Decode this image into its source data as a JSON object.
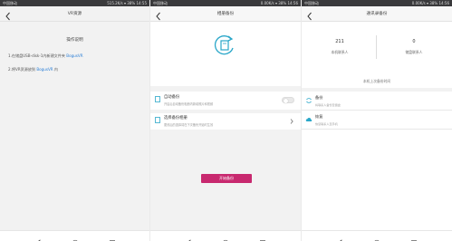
{
  "status_bar": {
    "carrier": "中国移动",
    "p1_right": "515.2K/s ▾ 38% 14:55",
    "p2_right": "0.00K/s ▾ 38% 14:56",
    "p3_right": "0.00K/s ▾ 38% 14:56"
  },
  "panel1": {
    "title": "VR资源",
    "heading": "操作说明",
    "line1_text": "1.在储盘USB-disk-1内新建文件夹 ",
    "line1_highlight": "BogusVR",
    "line2_text": "2.将VR资源放到 ",
    "line2_highlight": "BogusVR",
    "line2_suffix": " 内"
  },
  "panel2": {
    "title": "相册备份",
    "auto_backup_title": "自动备份",
    "auto_backup_sub": "开启后自动备份相册内新增照片和视频",
    "select_album_title": "选择备份相册",
    "select_album_sub": "更改后的选择将在下次备份开始时生效",
    "start_button": "开始备份"
  },
  "panel3": {
    "title": "通讯录备份",
    "local_count": "211",
    "local_label": "本机联系人",
    "disk_count": "0",
    "disk_label": "储盘联系人",
    "last_backup": "本机上次备份时间",
    "backup_title": "备份",
    "backup_sub": "将联系人备份至储盘",
    "restore_title": "恢复",
    "restore_sub": "恢复联系人至手机"
  },
  "colors": {
    "accent_blue": "#2b7fd6",
    "start_button": "#c8296f",
    "sync_icon": "#2aa7c9"
  }
}
